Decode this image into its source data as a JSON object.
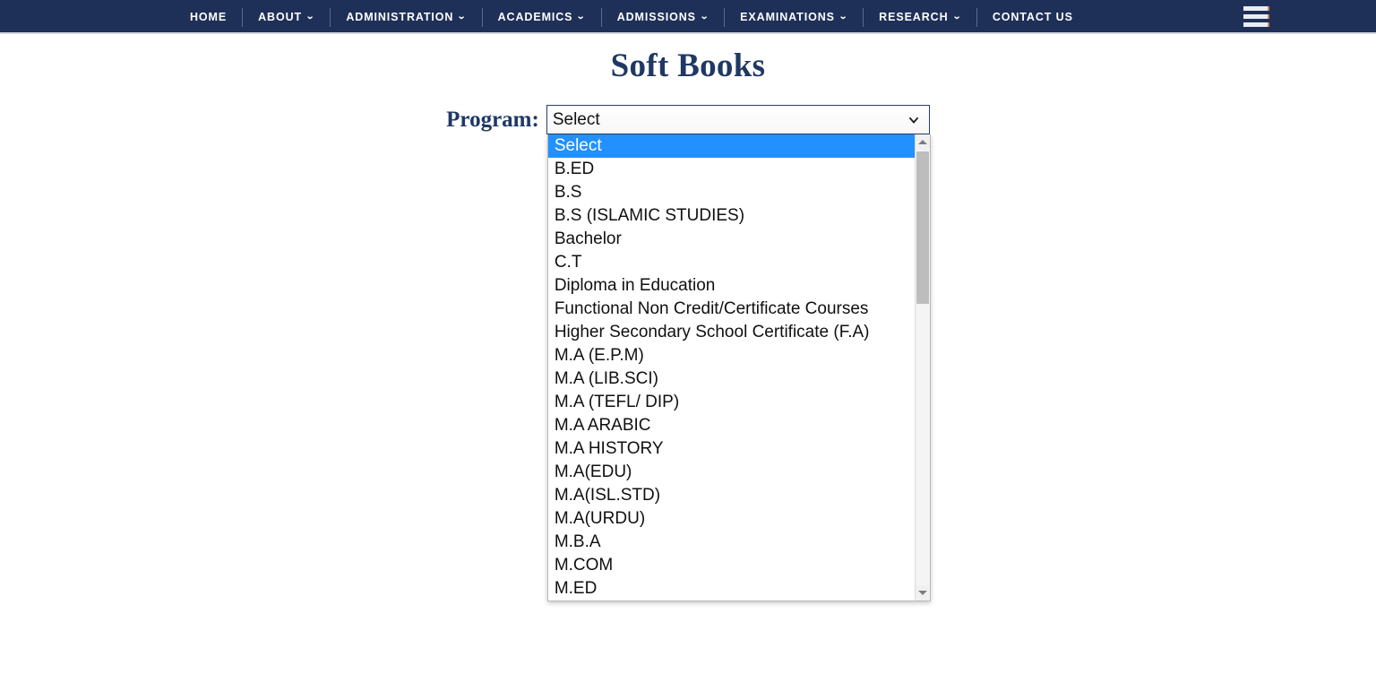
{
  "navbar": {
    "background_color": "#1e3058",
    "items": [
      {
        "label": "HOME",
        "has_caret": false
      },
      {
        "label": "ABOUT",
        "has_caret": true
      },
      {
        "label": "ADMINISTRATION",
        "has_caret": true
      },
      {
        "label": "ACADEMICS",
        "has_caret": true
      },
      {
        "label": "ADMISSIONS",
        "has_caret": true
      },
      {
        "label": "EXAMINATIONS",
        "has_caret": true
      },
      {
        "label": "RESEARCH",
        "has_caret": true
      },
      {
        "label": "CONTACT US",
        "has_caret": false
      }
    ],
    "caret_glyph": "⌄",
    "menu_icon": "hamburger-icon"
  },
  "page": {
    "title": "Soft Books",
    "title_color": "#1f3864"
  },
  "form": {
    "label": "Program:",
    "label_color": "#1f3864",
    "select": {
      "name": "program-select",
      "value": "Select",
      "expanded": true,
      "highlight_color": "#2291ff",
      "options": [
        "Select",
        "B.ED",
        "B.S",
        "B.S (ISLAMIC STUDIES)",
        "Bachelor",
        "C.T",
        "Diploma in Education",
        "Functional Non Credit/Certificate Courses",
        "Higher Secondary School Certificate (F.A)",
        "M.A (E.P.M)",
        "M.A (LIB.SCI)",
        "M.A (TEFL/ DIP)",
        "M.A ARABIC",
        "M.A HISTORY",
        "M.A(EDU)",
        "M.A(ISL.STD)",
        "M.A(URDU)",
        "M.B.A",
        "M.COM",
        "M.ED"
      ],
      "selected_index": 0
    }
  }
}
